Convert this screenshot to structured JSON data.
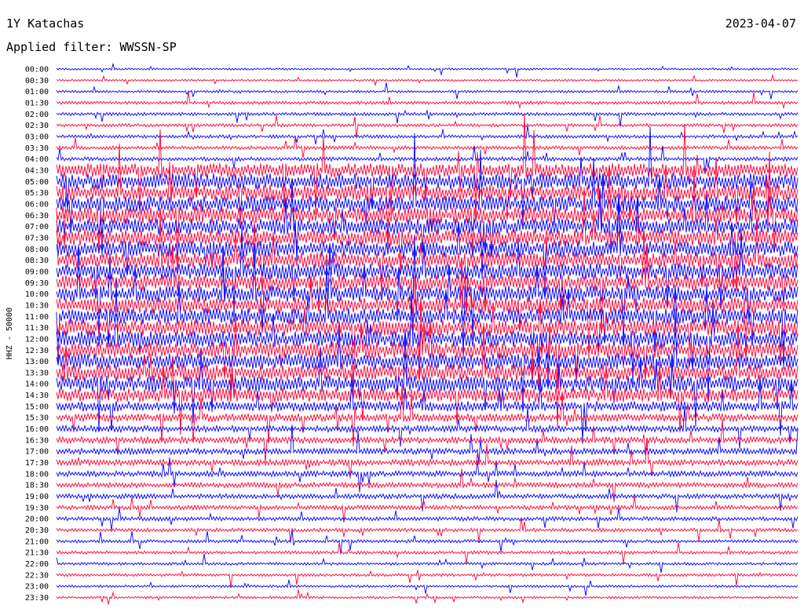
{
  "header": {
    "station": "1Y Katachas",
    "date": "2023-04-07",
    "filter": "Applied filter: WWSSN-SP"
  },
  "chart_data": {
    "type": "line",
    "title": "1Y Katachas",
    "ylabel": "HHZ - 50000",
    "row_labels": [
      "00:00",
      "00:30",
      "01:00",
      "01:30",
      "02:00",
      "02:30",
      "03:00",
      "03:30",
      "04:00",
      "04:30",
      "05:00",
      "05:30",
      "06:00",
      "06:30",
      "07:00",
      "07:30",
      "08:00",
      "08:30",
      "09:00",
      "09:30",
      "10:00",
      "10:30",
      "11:00",
      "11:30",
      "12:00",
      "12:30",
      "13:00",
      "13:30",
      "14:00",
      "14:30",
      "15:00",
      "15:30",
      "16:00",
      "16:30",
      "17:00",
      "17:30",
      "18:00",
      "18:30",
      "19:00",
      "19:30",
      "20:00",
      "20:30",
      "21:00",
      "21:30",
      "22:00",
      "22:30",
      "23:00",
      "23:30"
    ],
    "series_colors": [
      "#0000ff",
      "#ff0033"
    ],
    "amplitude_level": [
      0.5,
      0.5,
      0.6,
      0.8,
      0.8,
      0.8,
      0.8,
      0.9,
      1.0,
      3.5,
      4.0,
      4.0,
      4.0,
      4.0,
      4.0,
      4.0,
      4.0,
      4.0,
      4.0,
      4.0,
      4.0,
      4.0,
      4.0,
      4.0,
      4.0,
      4.0,
      4.0,
      4.0,
      4.0,
      3.5,
      2.5,
      2.0,
      1.6,
      1.6,
      1.5,
      1.5,
      1.4,
      1.3,
      1.2,
      1.1,
      1.0,
      0.9,
      0.8,
      0.8,
      0.7,
      0.7,
      0.6,
      0.6
    ]
  }
}
